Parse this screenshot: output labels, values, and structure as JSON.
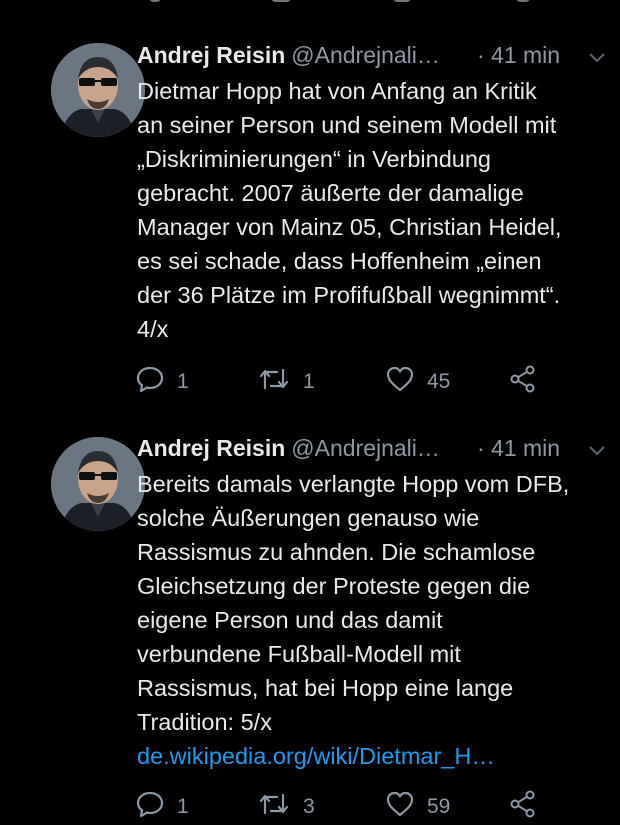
{
  "tweets": [
    {
      "author_name": "Andrej Reisin",
      "handle": "@Andrejnali…",
      "time": "· 41 min",
      "text_lines": [
        "Dietmar Hopp hat von Anfang an Kritik",
        "an seiner Person und seinem Modell mit",
        "„Diskriminierungen“ in Verbindung",
        "gebracht. 2007 äußerte der damalige",
        "Manager von Mainz 05, Christian Heidel,",
        "es sei schade, dass Hoffenheim „einen",
        "der 36 Plätze im Profifußball wegnimmt“.",
        "4/x"
      ],
      "link": "",
      "replies": "1",
      "retweets": "1",
      "likes": "45"
    },
    {
      "author_name": "Andrej Reisin",
      "handle": "@Andrejnali…",
      "time": "· 41 min",
      "text_lines": [
        "Bereits damals verlangte Hopp vom DFB,",
        "solche Äußerungen genauso wie",
        "Rassismus zu ahnden. Die schamlose",
        "Gleichsetzung der Proteste gegen die",
        "eigene Person und das damit",
        "verbundene Fußball-Modell mit",
        "Rassismus, hat bei Hopp eine lange",
        "Tradition: 5/x"
      ],
      "link": "de.wikipedia.org/wiki/Dietmar_H…",
      "replies": "1",
      "retweets": "3",
      "likes": "59"
    }
  ],
  "icons": {
    "reply": "reply-icon",
    "retweet": "retweet-icon",
    "like": "heart-icon",
    "share": "share-icon",
    "menu": "chevron-down-icon"
  },
  "colors": {
    "background": "#000000",
    "text": "#e7e9ea",
    "secondary": "#8b98a5",
    "link": "#1d9bf0"
  }
}
